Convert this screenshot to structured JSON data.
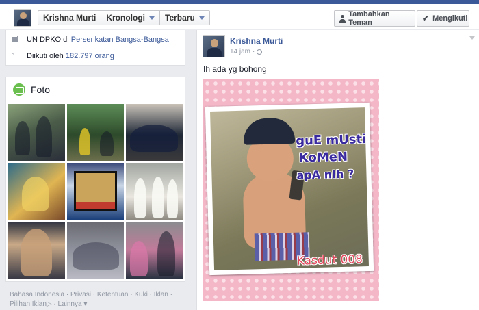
{
  "header": {
    "crumbs": [
      "Krishna Murti",
      "Kronologi",
      "Terbaru"
    ],
    "add_friend_label": "Tambahkan Teman",
    "follow_label": "Mengikuti"
  },
  "intro": {
    "work_prefix": "UN DPKO di ",
    "work_org": "Perserikatan Bangsa-Bangsa",
    "followers_prefix": "Diikuti oleh ",
    "followers_count": "182.797 orang"
  },
  "photos": {
    "title": "Foto",
    "thumbnails": [
      "photo-1",
      "photo-2",
      "photo-3",
      "photo-4",
      "photo-5",
      "photo-6",
      "photo-7",
      "photo-8",
      "photo-9"
    ]
  },
  "footer": {
    "links": [
      "Bahasa Indonesia",
      "Privasi",
      "Ketentuan",
      "Kuki",
      "Iklan",
      "Pilihan Iklan",
      "Lainnya"
    ]
  },
  "post": {
    "author": "Krishna Murti",
    "time": "14 jam",
    "text": "Ih ada yg bohong",
    "image_caption": [
      "guE mUsti",
      "KoMeN",
      "apA nIh ?"
    ],
    "image_watermark": "Kasdut 008"
  },
  "colors": {
    "brand_blue": "#3b5998",
    "link_blue": "#3b5998",
    "meme_pink": "#f3b7c8"
  }
}
